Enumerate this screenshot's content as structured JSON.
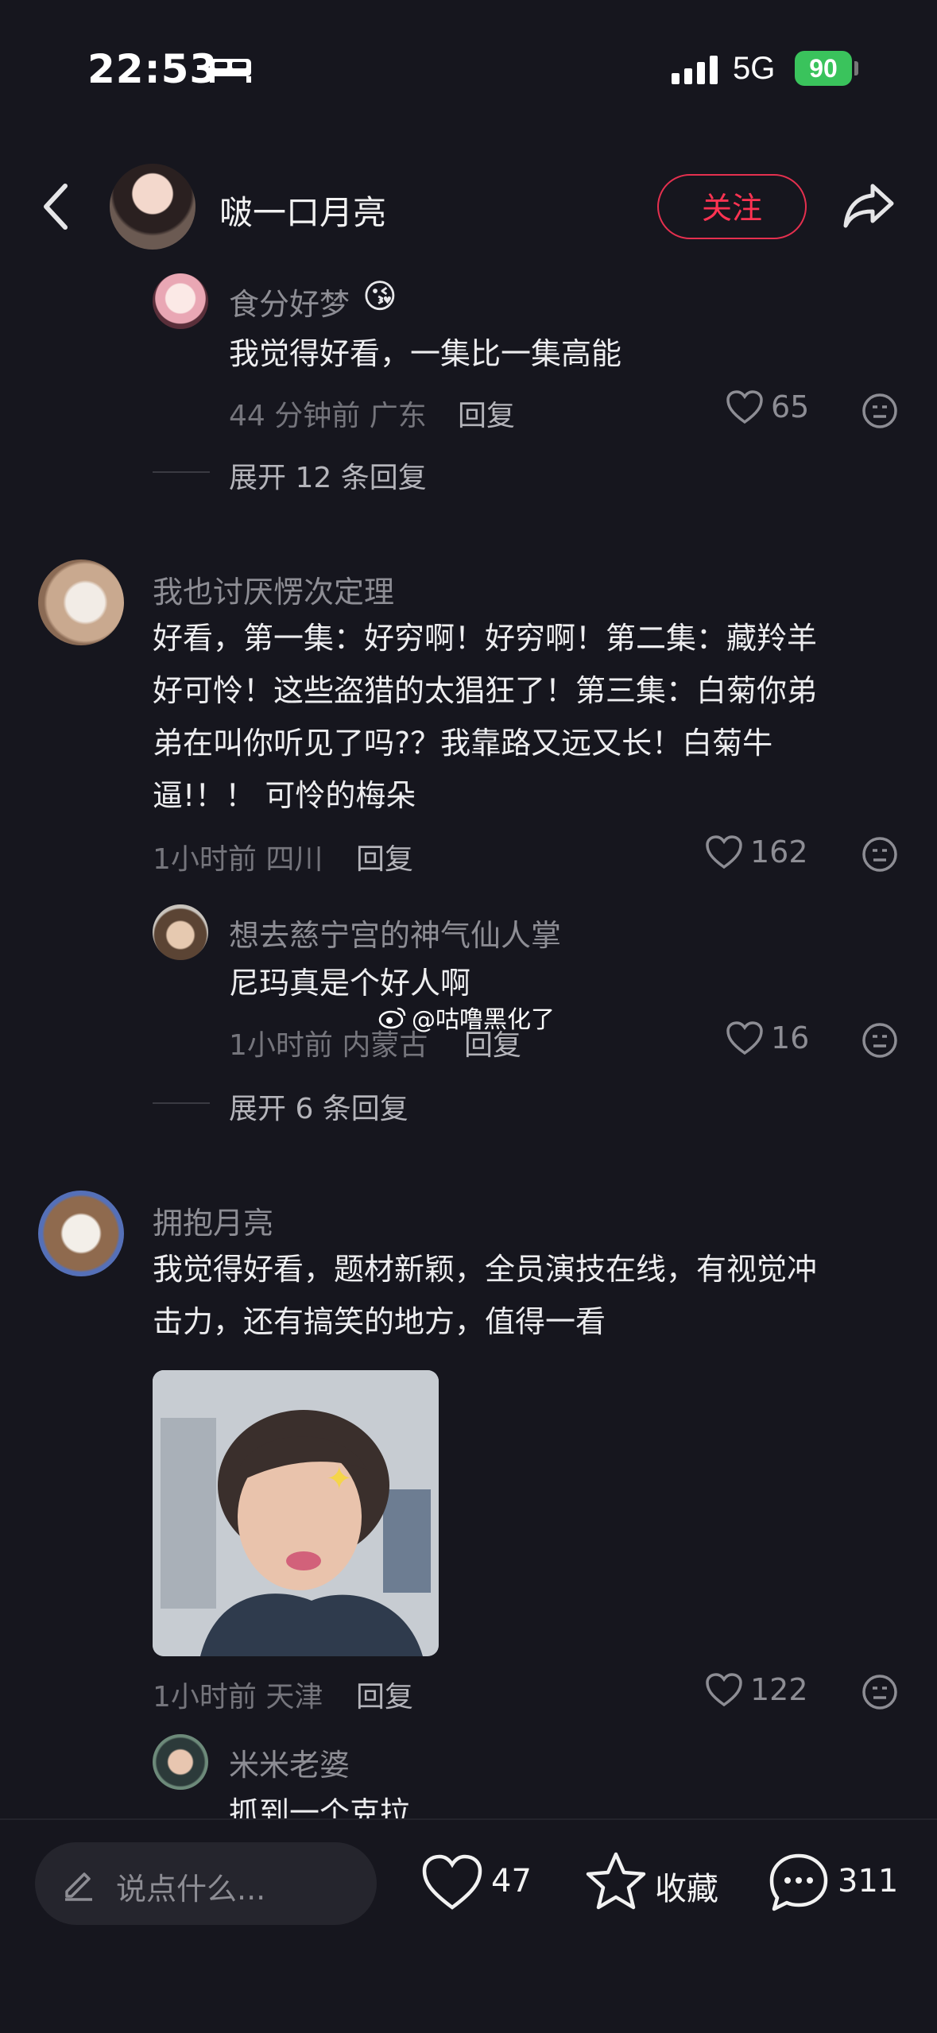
{
  "status": {
    "time": "22:53",
    "network": "5G",
    "battery": "90"
  },
  "header": {
    "title": "啵一口月亮",
    "follow_label": "关注"
  },
  "comments": [
    {
      "user": "食分好梦",
      "emoji": "😘",
      "text": "我觉得好看，一集比一集高能",
      "time_loc": "44 分钟前 广东",
      "reply": "回复",
      "likes": "65"
    },
    {
      "expand": "展开 12 条回复"
    },
    {
      "user": "我也讨厌愣次定理",
      "lines": [
        "好看，第一集：好穷啊！好穷啊！第二集：藏羚羊",
        "好可怜！这些盗猎的太猖狂了！第三集：白菊你弟",
        "弟在叫你听见了吗?？我靠路又远又长！白菊牛",
        "逼!！！ 可怜的梅朵"
      ],
      "time_loc": "1小时前 四川",
      "reply": "回复",
      "likes": "162"
    },
    {
      "user": "想去慈宁宫的神气仙人掌",
      "text": "尼玛真是个好人啊",
      "time_loc": "1小时前 内蒙古",
      "reply": "回复",
      "likes": "16"
    },
    {
      "expand": "展开 6 条回复"
    },
    {
      "user": "拥抱月亮",
      "lines": [
        "我觉得好看，题材新颖，全员演技在线，有视觉冲",
        "击力，还有搞笑的地方，值得一看"
      ],
      "time_loc": "1小时前 天津",
      "reply": "回复",
      "likes": "122"
    },
    {
      "user": "米米老婆",
      "text": "抓到一个克拉"
    }
  ],
  "watermark": "@咕噜黑化了",
  "bottom": {
    "placeholder": "说点什么...",
    "likes": "47",
    "collect_label": "收藏",
    "comments": "311"
  },
  "colors": {
    "background": "#16161e",
    "accent": "#ff3352",
    "battery": "#3ac35c"
  }
}
